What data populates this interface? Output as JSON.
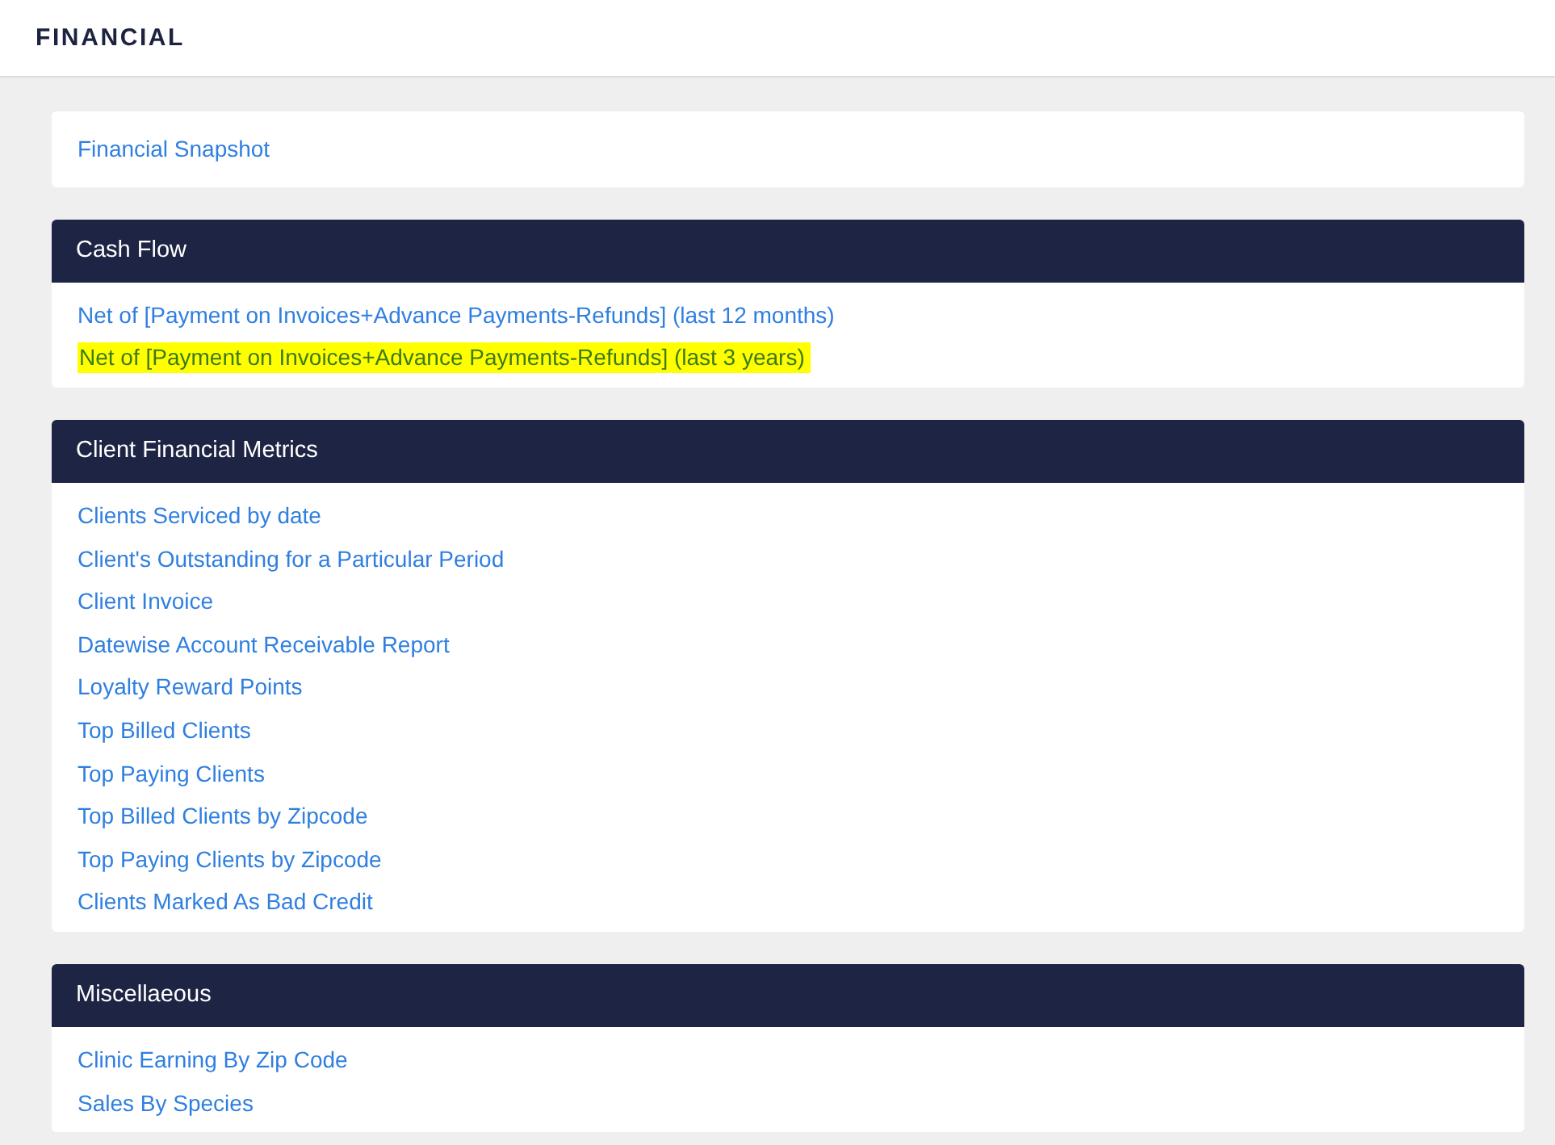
{
  "page_title": "FINANCIAL",
  "sections": [
    {
      "links": [
        {
          "label": "Financial Snapshot",
          "highlighted": false
        }
      ]
    },
    {
      "title": "Cash Flow",
      "links": [
        {
          "label": "Net of [Payment on Invoices+Advance Payments-Refunds] (last 12 months)",
          "highlighted": false
        },
        {
          "label": "Net of [Payment on Invoices+Advance Payments-Refunds] (last 3 years)",
          "highlighted": true
        }
      ]
    },
    {
      "title": "Client Financial Metrics",
      "links": [
        {
          "label": "Clients Serviced by date",
          "highlighted": false
        },
        {
          "label": "Client's Outstanding for a Particular Period",
          "highlighted": false
        },
        {
          "label": "Client Invoice",
          "highlighted": false
        },
        {
          "label": "Datewise Account Receivable Report",
          "highlighted": false
        },
        {
          "label": "Loyalty Reward Points",
          "highlighted": false
        },
        {
          "label": "Top Billed Clients",
          "highlighted": false
        },
        {
          "label": "Top Paying Clients",
          "highlighted": false
        },
        {
          "label": "Top Billed Clients by Zipcode",
          "highlighted": false
        },
        {
          "label": "Top Paying Clients by Zipcode",
          "highlighted": false
        },
        {
          "label": "Clients Marked As Bad Credit",
          "highlighted": false
        }
      ]
    },
    {
      "title": "Miscellaeous",
      "links": [
        {
          "label": "Clinic Earning By Zip Code",
          "highlighted": false
        },
        {
          "label": "Sales By Species",
          "highlighted": false
        }
      ]
    }
  ]
}
